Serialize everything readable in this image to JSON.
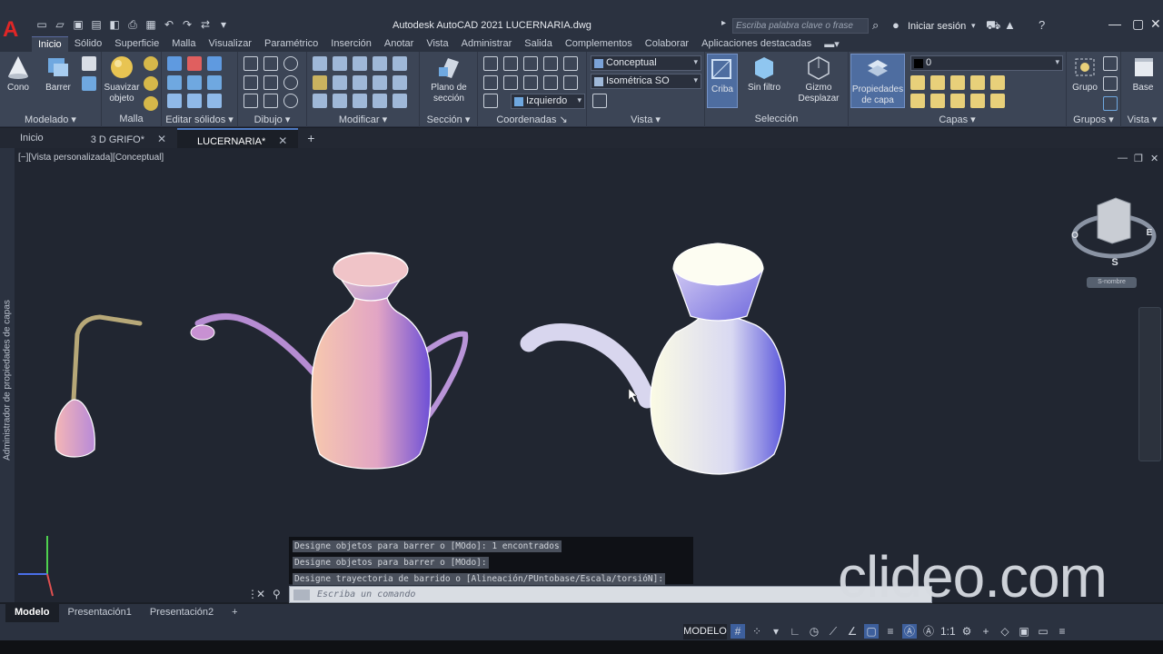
{
  "title_bar": {
    "app_title": "Autodesk AutoCAD 2021    LUCERNARIA.dwg",
    "search_placeholder": "Escriba palabra clave o frase",
    "sign_in": "Iniciar sesión"
  },
  "ribbon_tabs": [
    "Inicio",
    "Sólido",
    "Superficie",
    "Malla",
    "Visualizar",
    "Paramétrico",
    "Inserción",
    "Anotar",
    "Vista",
    "Administrar",
    "Salida",
    "Complementos",
    "Colaborar",
    "Aplicaciones destacadas"
  ],
  "ribbon": {
    "buttons": {
      "cono": "Cono",
      "barrer": "Barrer",
      "suavizar": "Suavizar objeto",
      "plano": "Plano de sección",
      "criba": "Criba",
      "sin_filtro": "Sin filtro",
      "gizmo": "Gizmo Desplazar",
      "propiedades": "Propiedades de capa",
      "grupo": "Grupo",
      "base": "Base"
    },
    "combos": {
      "visual_style": "Conceptual",
      "view": "Isométrica SO",
      "ucs": "Izquierdo",
      "layer": "0"
    },
    "panels": [
      "Modelado",
      "Malla",
      "Editar sólidos",
      "Dibujo",
      "Modificar",
      "Sección",
      "Coordenadas",
      "Vista",
      "Selección",
      "Capas",
      "Grupos",
      "Vista"
    ]
  },
  "doc_tabs": [
    "Inicio",
    "3 D GRIFO*",
    "LUCERNARIA*"
  ],
  "viewport": {
    "label": "[−][Vista personalizada][Conceptual]",
    "viewcube_south": "S",
    "viewcube_east": "E",
    "viewcube_west": "O",
    "viewcube_ucs": "S-nombre"
  },
  "side_palette_label": "Administrador de propiedades de capas",
  "command_history": [
    "Designe objetos para barrer o [MOdo]: 1 encontrados",
    "Designe objetos para barrer o [MOdo]:",
    "Designe trayectoria de barrido o [Alineación/PUntobase/Escala/torsióN]:"
  ],
  "command_placeholder": "Escriba un comando",
  "layout_tabs": [
    "Modelo",
    "Presentación1",
    "Presentación2"
  ],
  "status": {
    "model": "MODELO",
    "scale": "1:1"
  },
  "watermark": "clideo.com"
}
